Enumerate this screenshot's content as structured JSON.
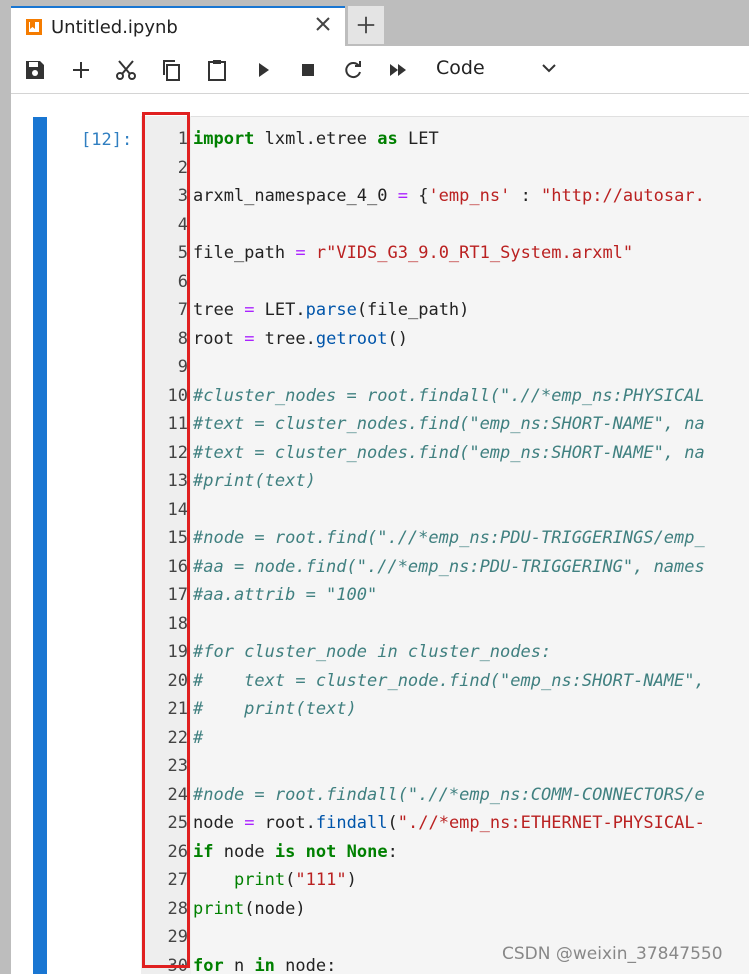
{
  "tab": {
    "title": "Untitled.ipynb",
    "icon": "notebook-icon",
    "close_icon": "close-icon",
    "add_icon": "plus-icon"
  },
  "toolbar": {
    "buttons": [
      "save-icon",
      "plus-icon",
      "scissors-icon",
      "copy-icon",
      "paste-icon",
      "run-icon",
      "stop-icon",
      "restart-icon",
      "fast-forward-icon"
    ],
    "cell_type": "Code"
  },
  "cell": {
    "prompt": "[12]:",
    "line_numbers": [
      "1",
      "2",
      "3",
      "4",
      "5",
      "6",
      "7",
      "8",
      "9",
      "10",
      "11",
      "12",
      "13",
      "14",
      "15",
      "16",
      "17",
      "18",
      "19",
      "20",
      "21",
      "22",
      "23",
      "24",
      "25",
      "26",
      "27",
      "28",
      "29",
      "30"
    ],
    "lines": [
      "import lxml.etree as LET",
      "",
      "arxml_namespace_4_0 = {'emp_ns' : \"http://autosar.",
      "",
      "file_path = r\"VIDS_G3_9.0_RT1_System.arxml\"",
      "",
      "tree = LET.parse(file_path)",
      "root = tree.getroot()",
      "",
      "#cluster_nodes = root.findall(\".//*emp_ns:PHYSICAL",
      "#text = cluster_nodes.find(\"emp_ns:SHORT-NAME\", na",
      "#text = cluster_nodes.find(\"emp_ns:SHORT-NAME\", na",
      "#print(text)",
      "",
      "#node = root.find(\".//*emp_ns:PDU-TRIGGERINGS/emp_",
      "#aa = node.find(\".//*emp_ns:PDU-TRIGGERING\", names",
      "#aa.attrib = \"100\"",
      "",
      "#for cluster_node in cluster_nodes:",
      "#    text = cluster_node.find(\"emp_ns:SHORT-NAME\",",
      "#    print(text)",
      "#",
      "",
      "#node = root.findall(\".//*emp_ns:COMM-CONNECTORS/e",
      "node = root.findall(\".//*emp_ns:ETHERNET-PHYSICAL-",
      "if node is not None:",
      "    print(\"111\")",
      "print(node)",
      "",
      "for n in node:"
    ]
  },
  "watermark": "CSDN @weixin_37847550",
  "colors": {
    "accent": "#1976d2",
    "selection_box": "#e02020",
    "prompt": "#307fc1"
  }
}
